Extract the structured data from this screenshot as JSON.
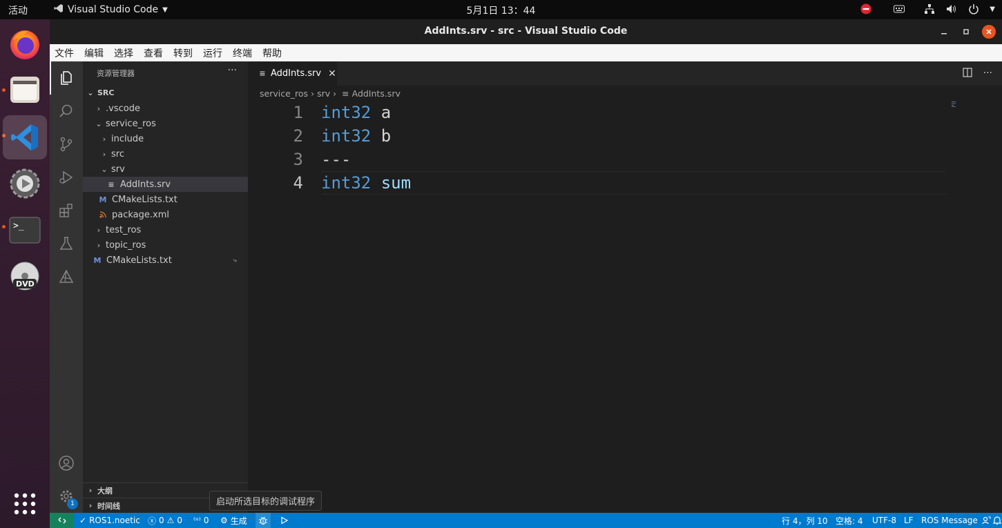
{
  "system_bar": {
    "activities": "活动",
    "app_name": "Visual Studio Code",
    "clock": "5月1日  13：44"
  },
  "window": {
    "title": "AddInts.srv - src - Visual Studio Code"
  },
  "menu": [
    "文件",
    "编辑",
    "选择",
    "查看",
    "转到",
    "运行",
    "终端",
    "帮助"
  ],
  "sidebar": {
    "header": "资源管理器",
    "more": "···",
    "root": "SRC",
    "tree": [
      {
        "label": ".vscode"
      },
      {
        "label": "service_ros"
      },
      {
        "label": "include"
      },
      {
        "label": "src"
      },
      {
        "label": "srv"
      },
      {
        "label": "AddInts.srv"
      },
      {
        "label": "CMakeLists.txt"
      },
      {
        "label": "package.xml"
      },
      {
        "label": "test_ros"
      },
      {
        "label": "topic_ros"
      },
      {
        "label": "CMakeLists.txt"
      }
    ],
    "sections": [
      {
        "label": "大纲"
      },
      {
        "label": "时间线"
      }
    ]
  },
  "activity_bar": {
    "settings_badge": "1"
  },
  "editor": {
    "tab_label": "AddInts.srv",
    "breadcrumb": [
      "service_ros",
      "srv",
      "AddInts.srv"
    ],
    "lines": [
      {
        "num": "1",
        "type": "int32",
        "name": " a"
      },
      {
        "num": "2",
        "type": "int32",
        "name": " b"
      },
      {
        "num": "3",
        "type": "",
        "name": "---"
      },
      {
        "num": "4",
        "type": "int32",
        "name": " sum"
      }
    ]
  },
  "tooltip": "启动所选目标的调试程序",
  "status": {
    "ros": "ROS1.noetic",
    "errors": "0",
    "warnings": "0",
    "ports": "0",
    "build": "生成",
    "cursor": "行 4，列 10",
    "spaces": "空格: 4",
    "encoding": "UTF-8",
    "eol": "LF",
    "language": "ROS Message"
  }
}
